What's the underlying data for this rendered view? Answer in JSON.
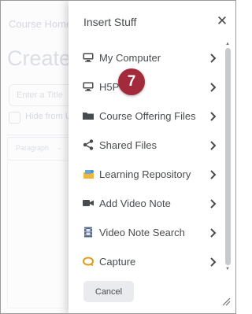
{
  "background": {
    "breadcrumb": "Course Home",
    "page_title": "Create",
    "title_placeholder": "Enter a Title",
    "hide_label": "Hide from U",
    "format_select": "Paragraph"
  },
  "dialog": {
    "title": "Insert Stuff",
    "close_icon": "close-icon",
    "items": [
      {
        "label": "My Computer",
        "icon": "computer-icon"
      },
      {
        "label": "H5P",
        "icon": "computer-icon"
      },
      {
        "label": "Course Offering Files",
        "icon": "folder-icon"
      },
      {
        "label": "Shared Files",
        "icon": "share-icon"
      },
      {
        "label": "Learning Repository",
        "icon": "repository-icon"
      },
      {
        "label": "Add Video Note",
        "icon": "video-camera-icon"
      },
      {
        "label": "Video Note Search",
        "icon": "film-icon"
      },
      {
        "label": "Capture",
        "icon": "capture-icon"
      }
    ],
    "cancel_label": "Cancel"
  },
  "callout": {
    "number": "7",
    "color": "#a32a3b"
  }
}
